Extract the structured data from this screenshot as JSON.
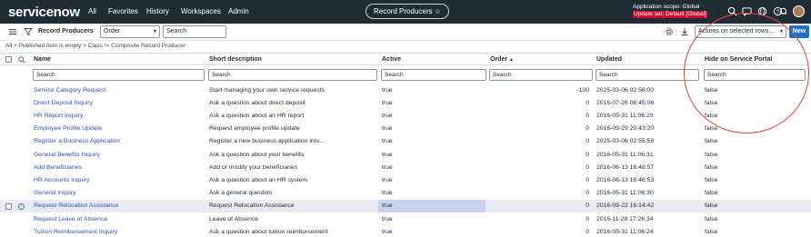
{
  "app": {
    "logo_text": "servicenow",
    "nav": [
      "All",
      "Favorites",
      "History",
      "Workspaces",
      "Admin"
    ],
    "record_title": "Record Producers",
    "scope_line1": "Application scope: Global",
    "scope_line2": "Update set: Default [Global]"
  },
  "listbar": {
    "title": "Record Producers",
    "field_select": "Order",
    "search_value": "Search",
    "actions_select": "Actions on selected rows...",
    "new_label": "New"
  },
  "breadcrumb": "All > Published item is empty > Class != Composite Record Producer",
  "columns": {
    "name": "Name",
    "short_description": "Short description",
    "active": "Active",
    "order": "Order",
    "order_sort": "▲",
    "updated": "Updated",
    "hide_on_portal": "Hide on Service Portal"
  },
  "search_placeholder": "Search",
  "rows": [
    {
      "name": "Service Category Request",
      "desc": "Start managing your own service requests",
      "active": "true",
      "order": "-100",
      "updated": "2025-03-06 02:56:00",
      "hide": "false"
    },
    {
      "name": "Direct Deposit Inquiry",
      "desc": "Ask a question about direct deposit",
      "active": "true",
      "order": "0",
      "updated": "2016-07-26 06:45:06",
      "hide": "false"
    },
    {
      "name": "HR Report Inquiry",
      "desc": "Ask a question about an HR report",
      "active": "true",
      "order": "0",
      "updated": "2016-05-31 11:06:29",
      "hide": "false"
    },
    {
      "name": "Employee Profile Update",
      "desc": "Request employee profile update",
      "active": "true",
      "order": "0",
      "updated": "2016-09-29 20:43:20",
      "hide": "false"
    },
    {
      "name": "Register a Business Application",
      "desc": "Register a new business application into...",
      "active": "true",
      "order": "0",
      "updated": "2025-03-06 02:55:58",
      "hide": "false"
    },
    {
      "name": "General Benefits Inquiry",
      "desc": "Ask a question about your benefits",
      "active": "true",
      "order": "0",
      "updated": "2016-05-31 11:06:31",
      "hide": "false"
    },
    {
      "name": "Add Beneficiaries",
      "desc": "Add or modify your beneficiaries",
      "active": "true",
      "order": "0",
      "updated": "2016-06-13 16:48:57",
      "hide": "false"
    },
    {
      "name": "HR Accounts Inquiry",
      "desc": "Ask a question about an HR system",
      "active": "true",
      "order": "0",
      "updated": "2016-06-13 16:46:53",
      "hide": "false"
    },
    {
      "name": "General Inquiry",
      "desc": "Ask a general question",
      "active": "true",
      "order": "0",
      "updated": "2016-05-31 11:06:30",
      "hide": "false"
    },
    {
      "name": "Request Relocation Assistance",
      "desc": "Request Relocation Assistance",
      "active": "true",
      "order": "0",
      "updated": "2016-09-22 16:14:42",
      "hide": "false"
    },
    {
      "name": "Request Leave of Absence",
      "desc": "Leave of Absence",
      "active": "true",
      "order": "0",
      "updated": "2016-11-28 17:26:34",
      "hide": "false"
    },
    {
      "name": "Tuition Reimbursement Inquiry",
      "desc": "Ask a question about tuition reimbursement",
      "active": "true",
      "order": "0",
      "updated": "2016-05-31 11:06:24",
      "hide": "false"
    }
  ],
  "highlighted_row": 9,
  "colors": {
    "nav_bg": "#1f2c33",
    "link": "#2e52b7",
    "new_button": "#1f6fc5",
    "annotation": "#e8403a"
  }
}
